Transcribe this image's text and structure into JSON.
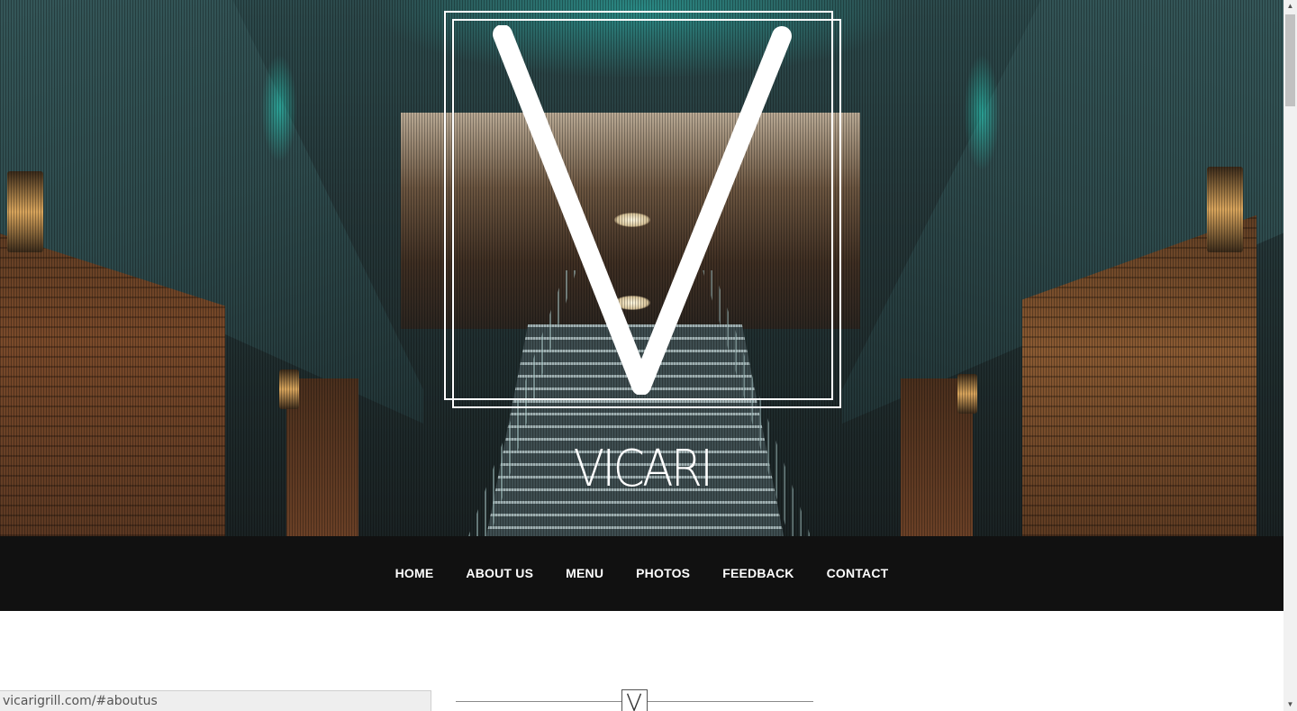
{
  "brand": {
    "name": "VICARI"
  },
  "nav": {
    "items": [
      {
        "label": "HOME"
      },
      {
        "label": "ABOUT US"
      },
      {
        "label": "MENU"
      },
      {
        "label": "PHOTOS"
      },
      {
        "label": "FEEDBACK"
      },
      {
        "label": "CONTACT"
      }
    ]
  },
  "status_bar": {
    "url": "vicarigrill.com/#aboutus"
  },
  "scrollbar": {
    "up_glyph": "▲",
    "down_glyph": "▼"
  },
  "colors": {
    "nav_background": "#111111",
    "nav_text": "#ffffff",
    "logo": "#ffffff",
    "accent_teal": "#2ad0c0"
  }
}
